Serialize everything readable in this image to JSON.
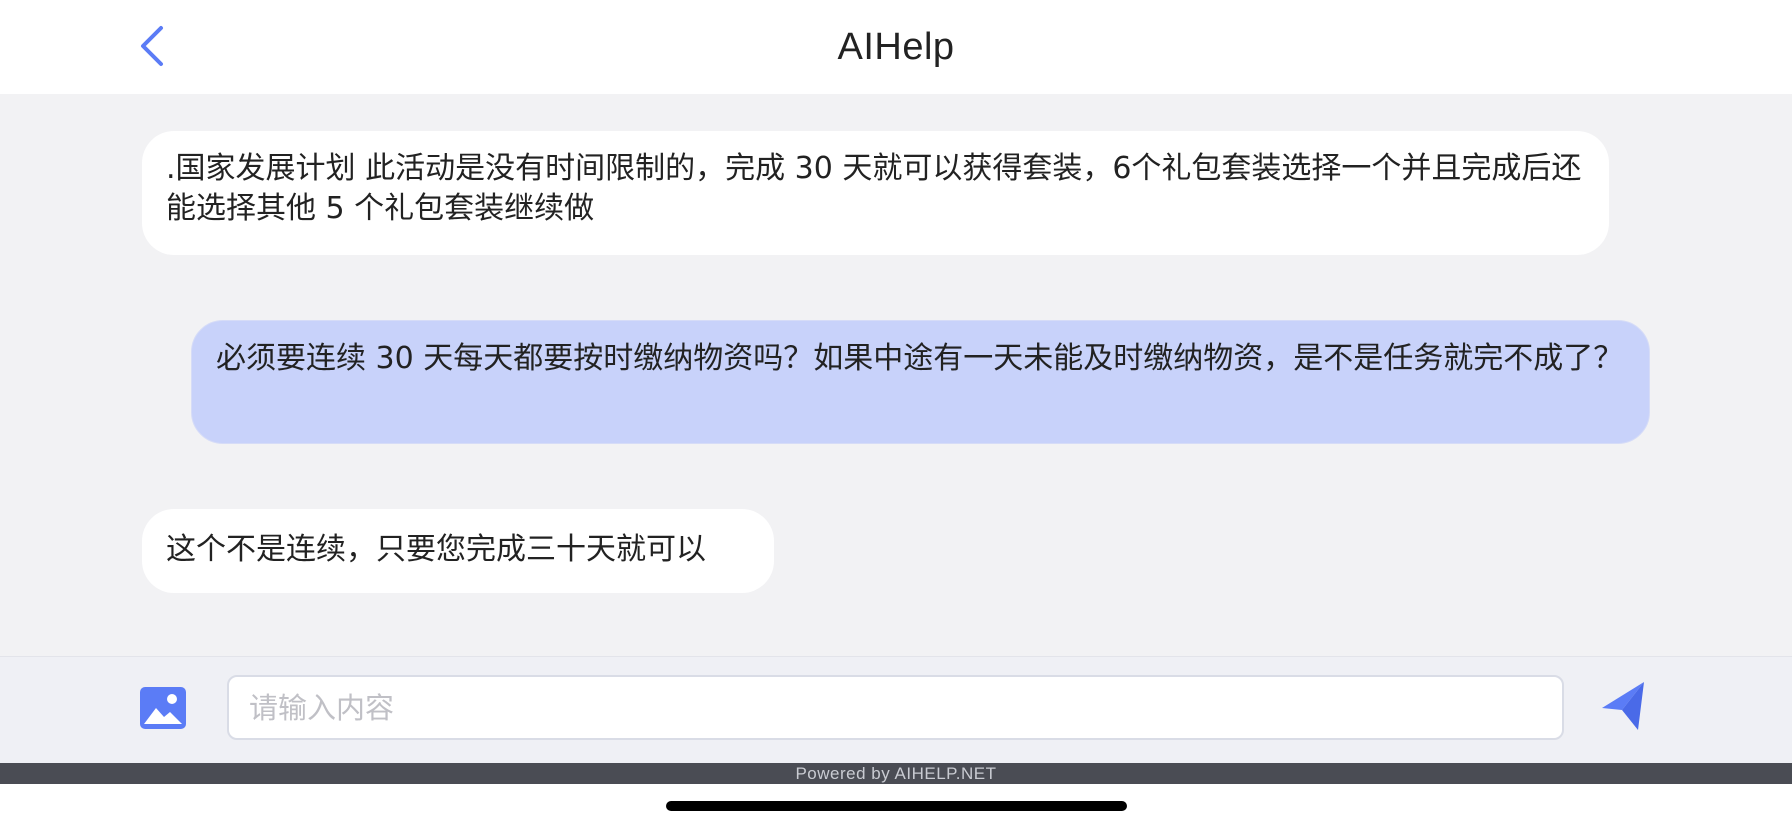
{
  "header": {
    "title": "AIHelp",
    "back_icon": "chevron-left-icon",
    "accent_color": "#5b7cf6"
  },
  "messages": [
    {
      "side": "left",
      "text": ".国家发展计划 此活动是没有时间限制的，完成 30 天就可以获得套装，6个礼包套装选择一个并且完成后还能选择其他 5 个礼包套装继续做"
    },
    {
      "side": "right",
      "text": "必须要连续 30 天每天都要按时缴纳物资吗？如果中途有一天未能及时缴纳物资，是不是任务就完不成了？"
    },
    {
      "side": "left",
      "text": "这个不是连续，只要您完成三十天就可以"
    }
  ],
  "composer": {
    "image_icon": "image-icon",
    "placeholder": "请输入内容",
    "value": "",
    "send_icon": "send-icon"
  },
  "footer": {
    "powered_by": "Powered by AIHELP.NET"
  },
  "colors": {
    "user_bubble": "#c8d2fa",
    "agent_bubble": "#ffffff",
    "background": "#f2f2f4",
    "icon_blue": "#5b7cf6"
  }
}
